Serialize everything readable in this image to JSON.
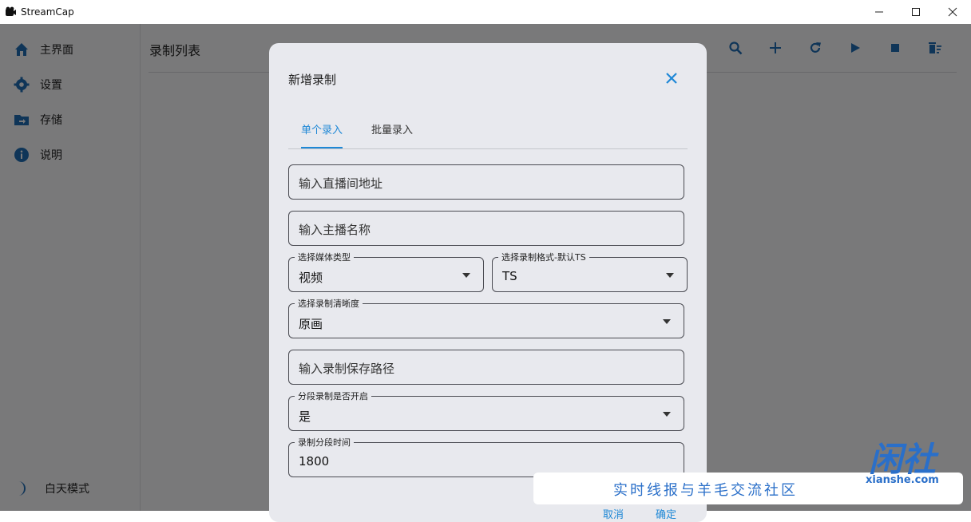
{
  "window": {
    "title": "StreamCap",
    "controls": [
      "minimize-icon",
      "maximize-icon",
      "close-icon"
    ]
  },
  "sidebar": {
    "items": [
      {
        "label": "主界面",
        "icon": "home-icon"
      },
      {
        "label": "设置",
        "icon": "gear-icon"
      },
      {
        "label": "存储",
        "icon": "folder-icon"
      },
      {
        "label": "说明",
        "icon": "info-icon"
      }
    ],
    "theme_toggle": {
      "label": "白天模式",
      "icon": "moon-icon"
    }
  },
  "main": {
    "title": "录制列表",
    "toolbar": [
      "filter-icon",
      "search-icon",
      "add-icon",
      "refresh-icon",
      "play-icon",
      "stop-icon",
      "delete-icon"
    ]
  },
  "dialog": {
    "title": "新增录制",
    "tabs": [
      {
        "label": "单个录入",
        "active": true
      },
      {
        "label": "批量录入",
        "active": false
      }
    ],
    "fields": {
      "url_placeholder": "输入直播间地址",
      "anchor_placeholder": "输入主播名称",
      "media_type": {
        "label": "选择媒体类型",
        "value": "视频"
      },
      "record_format": {
        "label": "选择录制格式-默认TS",
        "value": "TS"
      },
      "quality": {
        "label": "选择录制清晰度",
        "value": "原画"
      },
      "save_path_placeholder": "输入录制保存路径",
      "segment_enabled": {
        "label": "分段录制是否开启",
        "value": "是"
      },
      "segment_time": {
        "label": "录制分段时间",
        "value": "1800"
      }
    },
    "footer": {
      "cancel": "取消",
      "confirm": "确定"
    }
  },
  "watermark": {
    "logo": "闲社",
    "domain": "xianshe.com",
    "slogan": "实时线报与羊毛交流社区"
  },
  "colors": {
    "accent": "#1e88d6",
    "sidebar_icon": "#1f6bb0",
    "watermark": "#2a6fc9"
  }
}
